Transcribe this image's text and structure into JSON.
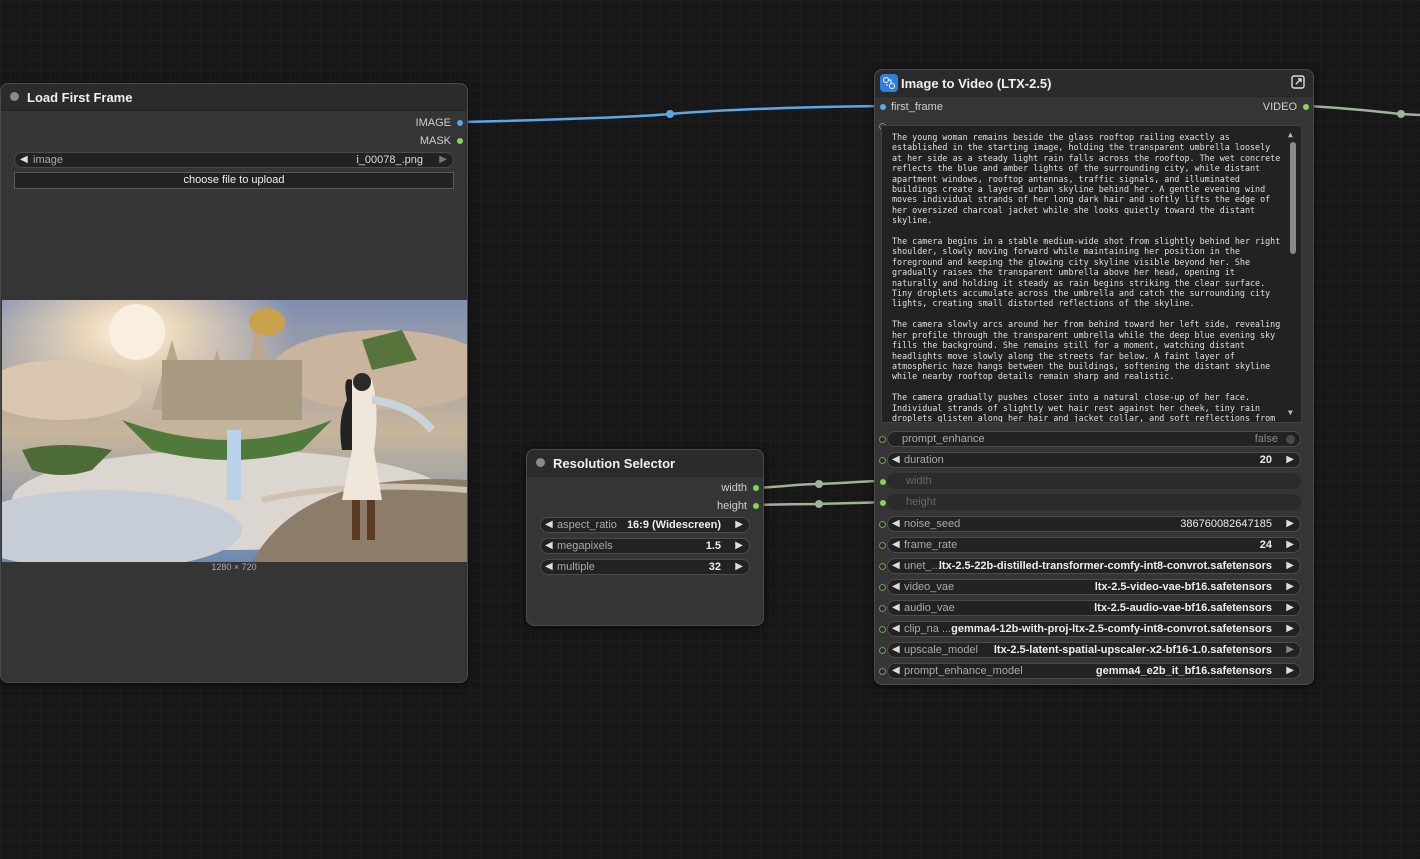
{
  "load_node": {
    "title": "Load First Frame",
    "outputs": {
      "image": "IMAGE",
      "mask": "MASK"
    },
    "image_widget": {
      "label": "image",
      "value": "i_00078_.png"
    },
    "upload_button": "choose file to upload",
    "image_size": "1280 × 720"
  },
  "res_node": {
    "title": "Resolution Selector",
    "outputs": {
      "width": "width",
      "height": "height"
    },
    "widgets": [
      {
        "label": "aspect_ratio",
        "value": "16:9 (Widescreen)"
      },
      {
        "label": "megapixels",
        "value": "1.5"
      },
      {
        "label": "multiple",
        "value": "32"
      }
    ]
  },
  "i2v_node": {
    "title": "Image to Video (LTX-2.5)",
    "input_label": "first_frame",
    "output_label": "VIDEO",
    "prompt": [
      "The young woman remains beside the glass rooftop railing exactly as established in the starting image, holding the transparent umbrella loosely at her side as a steady light rain falls across the rooftop. The wet concrete reflects the blue and amber lights of the surrounding city, while distant apartment windows, rooftop antennas, traffic signals, and illuminated buildings create a layered urban skyline behind her. A gentle evening wind moves individual strands of her long dark hair and softly lifts the edge of her oversized charcoal jacket while she looks quietly toward the distant skyline.",
      "The camera begins in a stable medium-wide shot from slightly behind her right shoulder, slowly moving forward while maintaining her position in the foreground and keeping the glowing city skyline visible beyond her. She gradually raises the transparent umbrella above her head, opening it naturally and holding it steady as rain begins striking the clear surface. Tiny droplets accumulate across the umbrella and catch the surrounding city lights, creating small distorted reflections of the skyline.",
      "The camera slowly arcs around her from behind toward her left side, revealing her profile through the transparent umbrella while the deep blue evening sky fills the background. She remains still for a moment, watching distant headlights move slowly along the streets far below. A faint layer of atmospheric haze hangs between the buildings, softening the distant skyline while nearby rooftop details remain sharp and realistic.",
      "The camera gradually pushes closer into a natural close-up of her face. Individual strands of slightly wet hair rest against her cheek, tiny rain droplets glisten along her hair and jacket collar, and soft reflections from distant city lights appear in her brown eyes. She slowly turns her eyes toward the camera without"
    ],
    "widgets": [
      {
        "label": "prompt_enhance",
        "value": "false",
        "type": "toggle"
      },
      {
        "label": "duration",
        "value": "20",
        "type": "number"
      },
      {
        "label": "width",
        "value": "",
        "type": "input"
      },
      {
        "label": "height",
        "value": "",
        "type": "input"
      },
      {
        "label": "noise_seed",
        "value": "386760082647185",
        "type": "number"
      },
      {
        "label": "frame_rate",
        "value": "24",
        "type": "number"
      },
      {
        "label": "unet_...",
        "value": "ltx-2.5-22b-distilled-transformer-comfy-int8-convrot.safetensors",
        "type": "combo"
      },
      {
        "label": "video_vae",
        "value": "ltx-2.5-video-vae-bf16.safetensors",
        "type": "combo"
      },
      {
        "label": "audio_vae",
        "value": "ltx-2.5-audio-vae-bf16.safetensors",
        "type": "combo"
      },
      {
        "label": "clip_na ...",
        "value": "gemma4-12b-with-proj-ltx-2.5-comfy-int8-convrot.safetensors",
        "type": "combo"
      },
      {
        "label": "upscale_model",
        "value": "ltx-2.5-latent-spatial-upscaler-x2-bf16-1.0.safetensors",
        "type": "combo"
      },
      {
        "label": "prompt_enhance_model",
        "value": "gemma4_e2b_it_bf16.safetensors",
        "type": "combo"
      }
    ]
  },
  "colors": {
    "image_link": "#5aa8e6",
    "int_link": "#9fb39a",
    "socket_green": "#7ed957",
    "socket_blue": "#5aa8e6"
  }
}
